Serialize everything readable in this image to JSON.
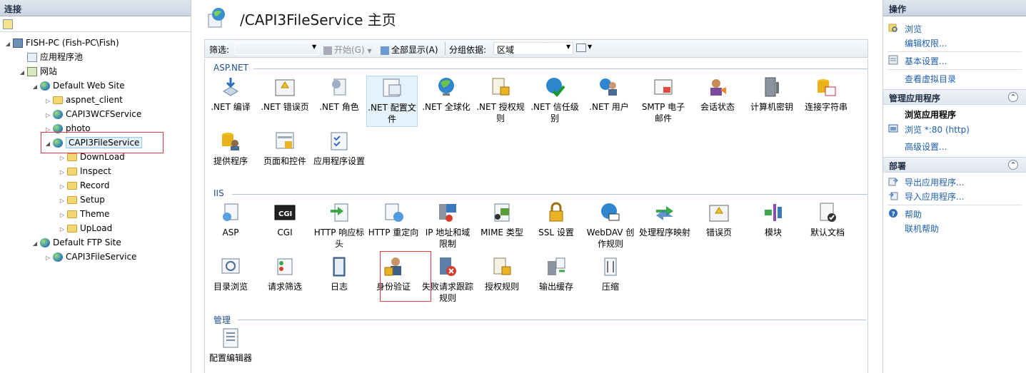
{
  "left": {
    "title": "连接",
    "tree": [
      {
        "label": "FISH-PC (Fish-PC\\Fish)",
        "expanded": "◢"
      },
      {
        "label": "应用程序池"
      },
      {
        "label": "网站",
        "expanded": "◢"
      },
      {
        "label": "Default Web Site",
        "expanded": "◢"
      },
      {
        "label": "aspnet_client",
        "expanded": "▷"
      },
      {
        "label": "CAPI3WCFService",
        "expanded": "▷"
      },
      {
        "label": "photo",
        "expanded": "▷"
      },
      {
        "label": "CAPI3FileService",
        "expanded": "◢"
      },
      {
        "label": "DownLoad",
        "expanded": "▷"
      },
      {
        "label": "Inspect",
        "expanded": "▷"
      },
      {
        "label": "Record",
        "expanded": "▷"
      },
      {
        "label": "Setup",
        "expanded": "▷"
      },
      {
        "label": "Theme",
        "expanded": "▷"
      },
      {
        "label": "UpLoad",
        "expanded": "▷"
      },
      {
        "label": "Default FTP Site",
        "expanded": "◢"
      },
      {
        "label": "CAPI3FileService",
        "expanded": "▷"
      }
    ]
  },
  "center": {
    "title": "/CAPI3FileService 主页",
    "filter_label": "筛选:",
    "filter_value": "",
    "start_label": "开始(G)",
    "show_all_label": "全部显示(A)",
    "group_label": "分组依据:",
    "group_value": "区域",
    "sections": {
      "aspnet": "ASP.NET",
      "iis": "IIS",
      "manage": "管理"
    },
    "aspnet_items": [
      ".NET 编译",
      ".NET 错误页",
      ".NET 角色",
      ".NET 配置文件",
      ".NET 全球化",
      ".NET 授权规则",
      ".NET 信任级别",
      ".NET 用户",
      "SMTP 电子邮件",
      "会话状态",
      "计算机密钥",
      "连接字符串",
      "提供程序",
      "页面和控件",
      "应用程序设置"
    ],
    "iis_items": [
      "ASP",
      "CGI",
      "HTTP 响应标头",
      "HTTP 重定向",
      "IP 地址和域限制",
      "MIME 类型",
      "SSL 设置",
      "WebDAV 创作规则",
      "处理程序映射",
      "错误页",
      "模块",
      "默认文档",
      "目录浏览",
      "请求筛选",
      "日志",
      "身份验证",
      "失败请求跟踪规则",
      "授权规则",
      "输出缓存",
      "压缩"
    ],
    "manage_items": [
      "配置编辑器"
    ]
  },
  "right": {
    "title": "操作",
    "browse": "浏览",
    "edit_perms": "编辑权限...",
    "basic_settings": "基本设置...",
    "view_vdirs": "查看虚拟目录",
    "manage_app": "管理应用程序",
    "browse_app": "浏览应用程序",
    "browse_port": "浏览 *:80 (http)",
    "advanced": "高级设置...",
    "deploy": "部署",
    "export_app": "导出应用程序...",
    "import_app": "导入应用程序...",
    "help": "帮助",
    "online_help": "联机帮助",
    "collapse_glyph": "^"
  }
}
